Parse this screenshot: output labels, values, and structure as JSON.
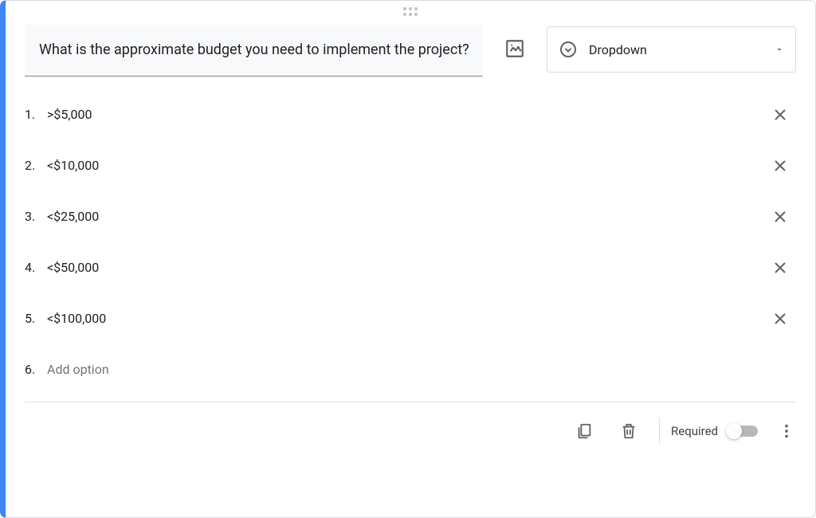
{
  "question": {
    "text": "What is the approximate budget you need to implement the project?"
  },
  "typeSelector": {
    "label": "Dropdown"
  },
  "options": [
    {
      "index": "1.",
      "text": ">$5,000"
    },
    {
      "index": "2.",
      "text": "<$10,000"
    },
    {
      "index": "3.",
      "text": "<$25,000"
    },
    {
      "index": "4.",
      "text": "<$50,000"
    },
    {
      "index": "5.",
      "text": "<$100,000"
    }
  ],
  "addOption": {
    "index": "6.",
    "placeholder": "Add option"
  },
  "footer": {
    "requiredLabel": "Required",
    "requiredOn": false
  }
}
